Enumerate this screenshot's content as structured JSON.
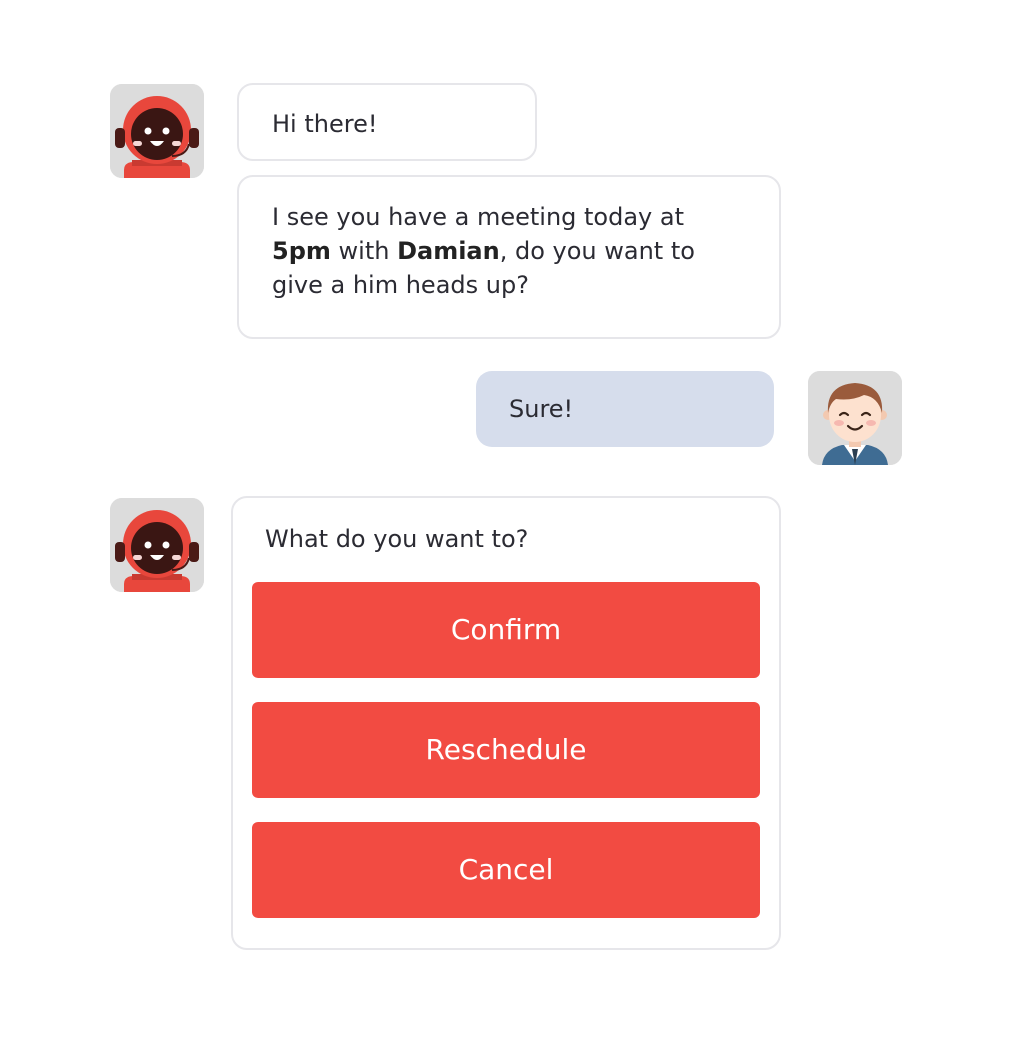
{
  "messages": {
    "greeting": "Hi there!",
    "meeting": {
      "prefix": "I see you have a meeting today at ",
      "time": "5pm",
      "middle": " with ",
      "person": "Damian",
      "suffix": ", do you want to give a him heads up?"
    },
    "user_reply": "Sure!",
    "question": "What do you want to?"
  },
  "actions": {
    "confirm": "Confirm",
    "reschedule": "Reschedule",
    "cancel": "Cancel"
  },
  "icons": {
    "bot": "bot-avatar-icon",
    "user": "user-avatar-icon"
  },
  "colors": {
    "accent": "#f24b42",
    "user_bubble": "#d6ddec",
    "bubble_border": "#e6e6ea",
    "avatar_bg": "#dcdcdc"
  }
}
